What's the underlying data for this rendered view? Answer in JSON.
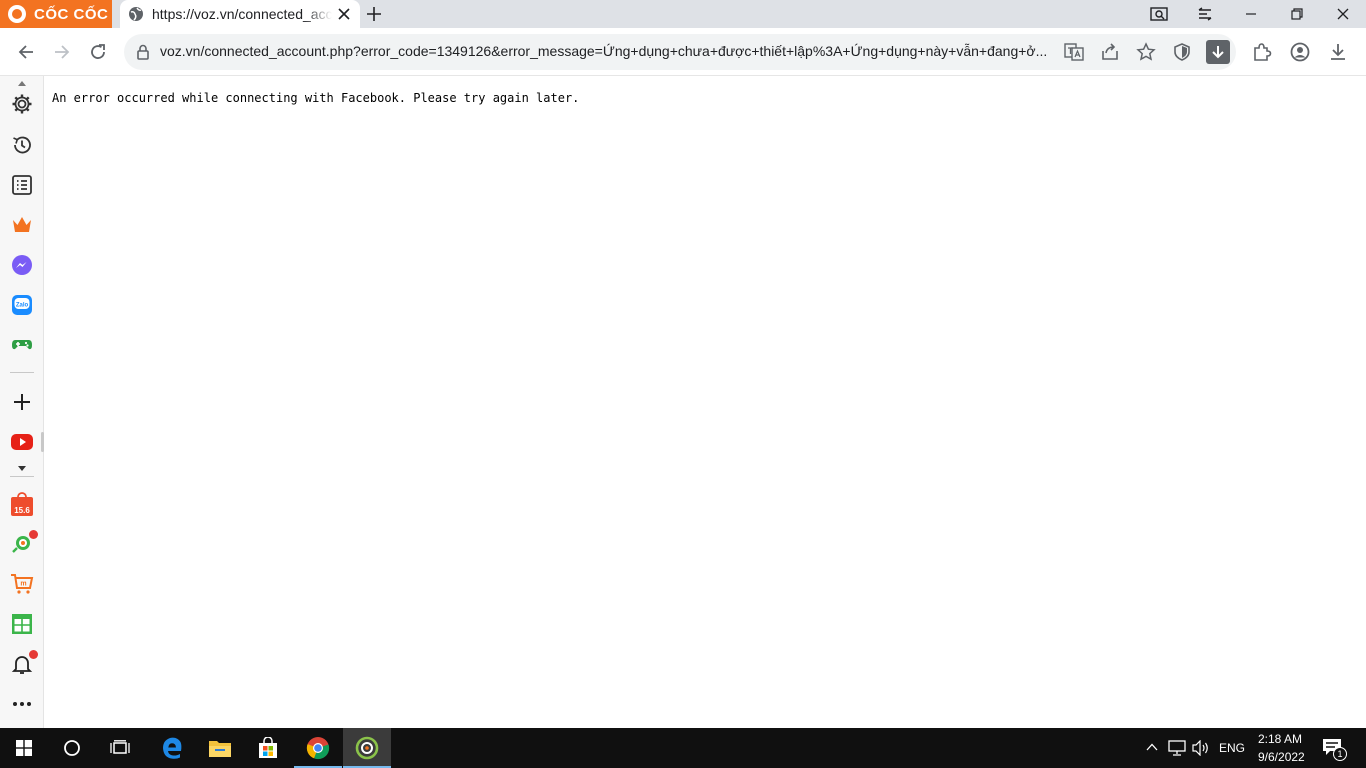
{
  "browser": {
    "brand": "CỐC CỐC",
    "tab_title": "https://voz.vn/connected_account.php?error_code=1349126",
    "url": "voz.vn/connected_account.php?error_code=1349126&error_message=Ứng+dụng+chưa+được+thiết+lập%3A+Ứng+dụng+này+vẫn+đang+ở..."
  },
  "page": {
    "message": "An error occurred while connecting with Facebook. Please try again later."
  },
  "sidebar": {
    "badge_label": "15.6"
  },
  "tray": {
    "language": "ENG",
    "time": "2:18 AM",
    "date": "9/6/2022",
    "notification_count": "1"
  },
  "colors": {
    "brand": "#f37321",
    "tab_strip": "#dee1e6",
    "taskbar": "#101010"
  }
}
